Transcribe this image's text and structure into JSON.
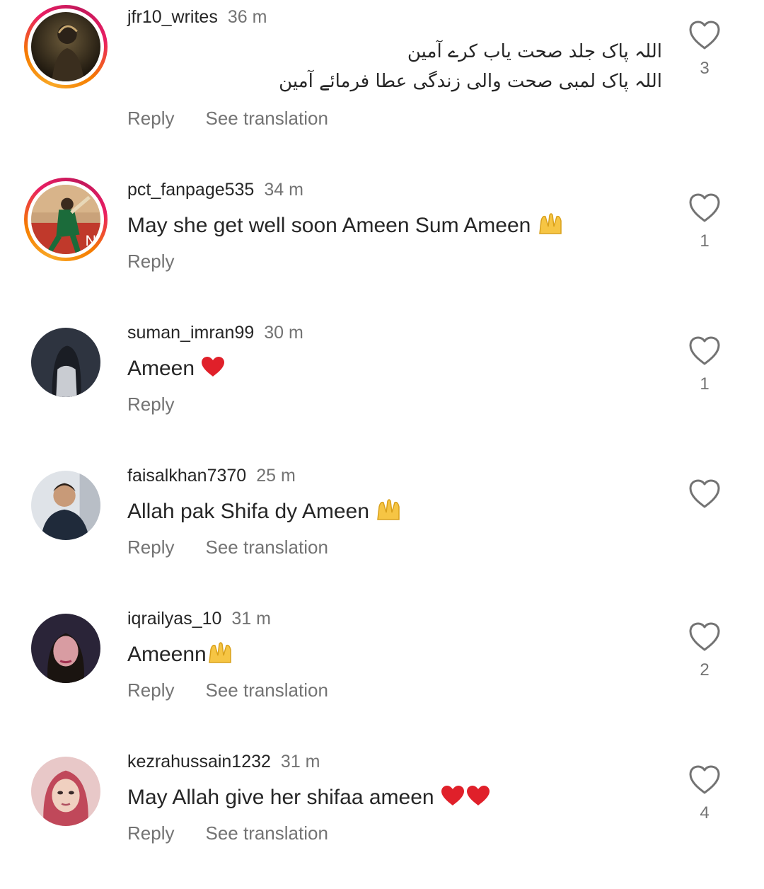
{
  "comments": [
    {
      "username": "jfr10_writes",
      "time": "36 m",
      "text_line1": "اللہ پاک جلد صحت یاب کرے آمین",
      "text_line2": "اللہ پاک لمبی صحت والی زندگی عطا فرمائے آمین",
      "reply_label": "Reply",
      "translation_label": "See translation",
      "likes": "3",
      "avatar": "avatar-photo",
      "has_story_ring": true,
      "like_icon": "heart-outline-icon"
    },
    {
      "username": "pct_fanpage535",
      "time": "34 m",
      "text": "May she get well soon Ameen Sum Ameen",
      "emoji": "folded-hands-emoji",
      "reply_label": "Reply",
      "likes": "1",
      "avatar": "avatar-cricket",
      "has_story_ring": true,
      "like_icon": "heart-outline-icon"
    },
    {
      "username": "suman_imran99",
      "time": "30 m",
      "text": "Ameen",
      "emoji": "red-heart-emoji",
      "reply_label": "Reply",
      "likes": "1",
      "avatar": "avatar-dark",
      "has_story_ring": false,
      "like_icon": "heart-outline-icon"
    },
    {
      "username": "faisalkhan7370",
      "time": "25 m",
      "text": "Allah pak Shifa dy Ameen",
      "emoji": "folded-hands-emoji",
      "reply_label": "Reply",
      "translation_label": "See translation",
      "likes": "",
      "avatar": "avatar-man",
      "has_story_ring": false,
      "like_icon": "heart-outline-icon"
    },
    {
      "username": "iqrailyas_10",
      "time": "31 m",
      "text": "Ameenn",
      "emoji": "folded-hands-emoji",
      "reply_label": "Reply",
      "translation_label": "See translation",
      "likes": "2",
      "avatar": "avatar-woman-1",
      "has_story_ring": false,
      "like_icon": "heart-outline-icon"
    },
    {
      "username": "kezrahussain1232",
      "time": "31 m",
      "text": "May Allah give her shifaa ameen",
      "emoji": "two-red-hearts-emoji",
      "reply_label": "Reply",
      "translation_label": "See translation",
      "likes": "4",
      "avatar": "avatar-woman-2",
      "has_story_ring": false,
      "like_icon": "heart-outline-icon"
    }
  ],
  "colors": {
    "text_primary": "#262626",
    "text_secondary": "#737373",
    "heart_red": "#e0202a",
    "folded_hands": "#f6c544",
    "ring_start": "#f9a825",
    "ring_end": "#e91e63"
  }
}
